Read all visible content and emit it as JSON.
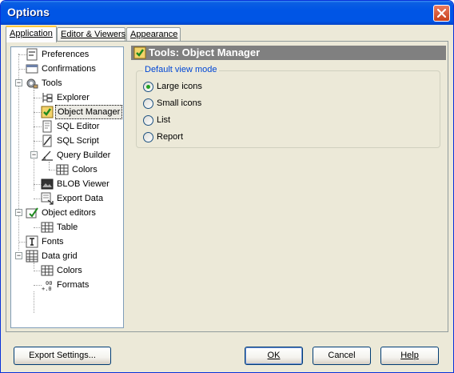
{
  "window": {
    "title": "Options"
  },
  "tabs": [
    {
      "label": "Application",
      "active": true
    },
    {
      "label": "Editor & Viewers",
      "active": false
    },
    {
      "label": "Appearance",
      "active": false
    }
  ],
  "tree": {
    "items": [
      {
        "label": "Preferences",
        "icon": "preferences-icon"
      },
      {
        "label": "Confirmations",
        "icon": "confirmations-icon"
      },
      {
        "label": "Tools",
        "icon": "tools-icon",
        "expanded": true
      },
      {
        "label": "Explorer",
        "icon": "explorer-icon"
      },
      {
        "label": "Object Manager",
        "icon": "object-manager-icon",
        "selected": true
      },
      {
        "label": "SQL Editor",
        "icon": "sql-editor-icon"
      },
      {
        "label": "SQL Script",
        "icon": "sql-script-icon"
      },
      {
        "label": "Query Builder",
        "icon": "query-builder-icon",
        "expanded": true
      },
      {
        "label": "Colors",
        "icon": "colors-icon"
      },
      {
        "label": "BLOB Viewer",
        "icon": "blob-viewer-icon"
      },
      {
        "label": "Export Data",
        "icon": "export-data-icon"
      },
      {
        "label": "Object editors",
        "icon": "object-editors-icon",
        "expanded": true
      },
      {
        "label": "Table",
        "icon": "table-icon"
      },
      {
        "label": "Fonts",
        "icon": "fonts-icon"
      },
      {
        "label": "Data grid",
        "icon": "data-grid-icon",
        "expanded": true
      },
      {
        "label": "Colors",
        "icon": "colors-icon"
      },
      {
        "label": "Formats",
        "icon": "formats-icon"
      }
    ]
  },
  "page": {
    "title": "Tools: Object Manager",
    "group_label": "Default view mode",
    "view_modes": [
      {
        "label": "Large icons",
        "selected": true
      },
      {
        "label": "Small icons",
        "selected": false
      },
      {
        "label": "List",
        "selected": false
      },
      {
        "label": "Report",
        "selected": false
      }
    ]
  },
  "buttons": {
    "export_settings": "Export Settings...",
    "ok": "OK",
    "cancel": "Cancel",
    "help": "Help"
  },
  "colors": {
    "title_bar": "#0055e5",
    "dialog_face": "#ece9d8",
    "header_bar": "#808080",
    "group_legend": "#0046d5",
    "radio_selected": "#21a121"
  }
}
